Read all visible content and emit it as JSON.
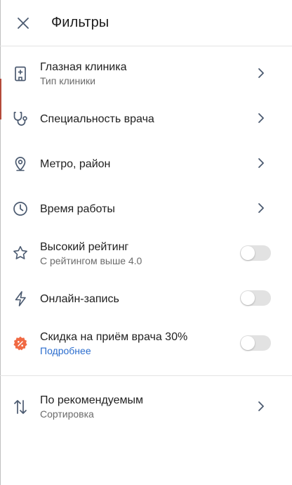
{
  "header": {
    "title": "Фильтры",
    "close_icon": "close-icon"
  },
  "colors": {
    "icon": "#4b5a70",
    "link": "#2b6dce",
    "toggle_off": "#e2e2e2",
    "discount_badge": "#f06a44"
  },
  "filters": [
    {
      "icon": "clinic-building-icon",
      "label": "Глазная клиника",
      "sub": "Тип клиники",
      "control": "chevron"
    },
    {
      "icon": "stethoscope-icon",
      "label": "Специальность врача",
      "control": "chevron"
    },
    {
      "icon": "location-pin-icon",
      "label": "Метро, район",
      "control": "chevron"
    },
    {
      "icon": "clock-icon",
      "label": "Время работы",
      "control": "chevron"
    },
    {
      "icon": "star-icon",
      "label": "Высокий рейтинг",
      "sub": "С рейтингом выше 4.0",
      "control": "toggle",
      "on": false
    },
    {
      "icon": "lightning-icon",
      "label": "Онлайн-запись",
      "control": "toggle",
      "on": false
    },
    {
      "icon": "discount-badge-icon",
      "label": "Скидка на приём врача 30%",
      "sub": "Подробнее",
      "control": "toggle",
      "on": false
    }
  ],
  "sort": {
    "icon": "sort-arrows-icon",
    "label": "По рекомендуемым",
    "sub": "Сортировка"
  }
}
